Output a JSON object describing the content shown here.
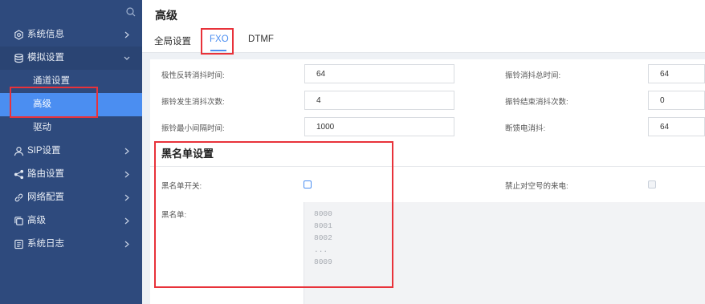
{
  "colors": {
    "sidebar_bg": "#2e4a7d",
    "accent": "#4b8ef1",
    "highlight": "#e8323a"
  },
  "sidebar": {
    "search_icon": "search-icon",
    "items": [
      {
        "label": "系统信息",
        "icon": "gear-icon"
      },
      {
        "label": "模拟设置",
        "icon": "database-icon",
        "expanded": true
      },
      {
        "label": "SIP设置",
        "icon": "user-icon"
      },
      {
        "label": "路由设置",
        "icon": "share-icon"
      },
      {
        "label": "网络配置",
        "icon": "link-icon"
      },
      {
        "label": "高级",
        "icon": "copy-icon"
      },
      {
        "label": "系统日志",
        "icon": "log-icon"
      }
    ],
    "sub_items": [
      {
        "label": "通道设置"
      },
      {
        "label": "高级",
        "active": true
      },
      {
        "label": "驱动"
      }
    ]
  },
  "header": {
    "title": "高级",
    "tabs": [
      {
        "label": "全局设置"
      },
      {
        "label": "FXO",
        "active": true
      },
      {
        "label": "DTMF"
      }
    ]
  },
  "form": {
    "fields": [
      {
        "label": "极性反转消抖时间:",
        "value": "64"
      },
      {
        "label": "振铃消抖总时间:",
        "value": "64"
      },
      {
        "label": "振铃发生消抖次数:",
        "value": "4"
      },
      {
        "label": "振铃结束消抖次数:",
        "value": "0"
      },
      {
        "label": "振铃最小间隔时间:",
        "value": "1000"
      },
      {
        "label": "断馈电消抖:",
        "value": "64"
      }
    ]
  },
  "blacklist": {
    "title": "黑名单设置",
    "switch_label": "黑名单开关:",
    "switch_checked": false,
    "forbid_label": "禁止对空号的来电:",
    "forbid_checked": false,
    "list_label": "黑名单:",
    "placeholder_lines": [
      "8000",
      "8001",
      "8002",
      "...",
      "8009"
    ]
  }
}
